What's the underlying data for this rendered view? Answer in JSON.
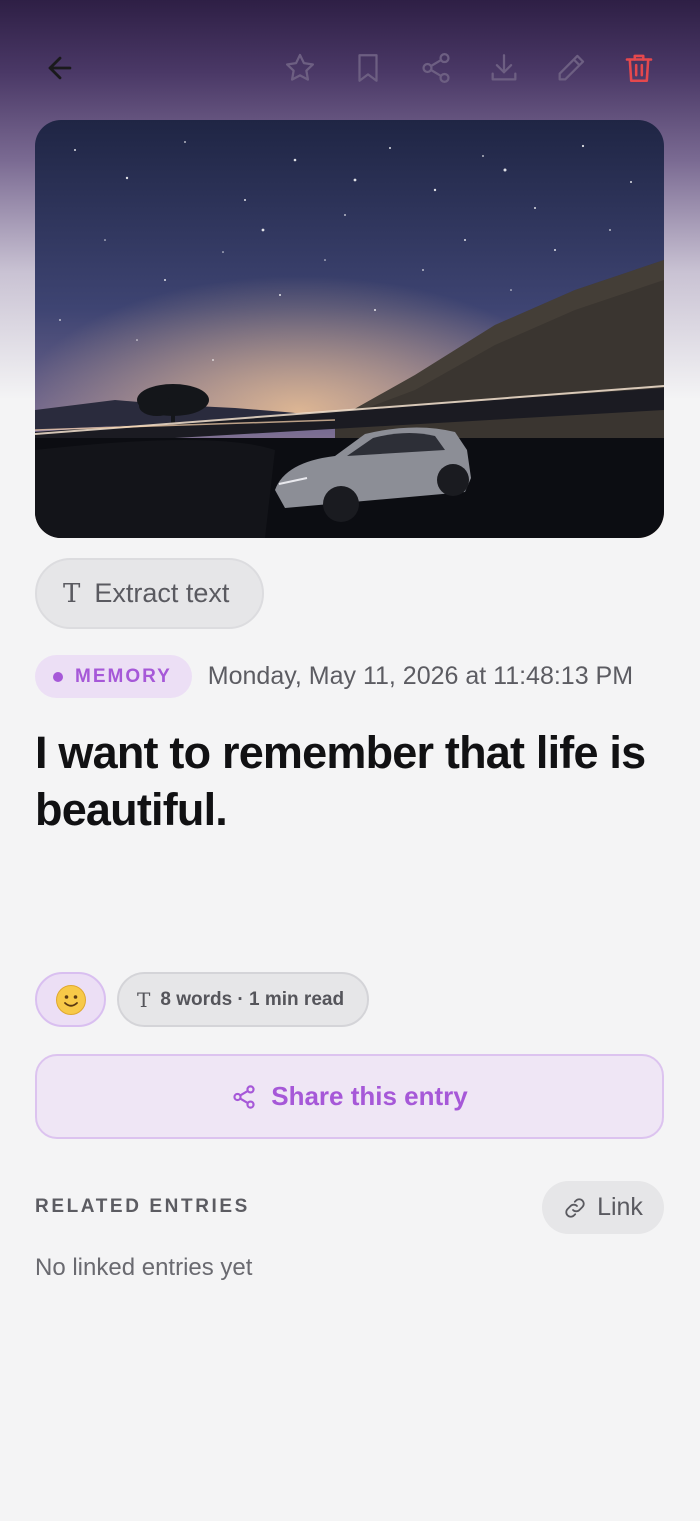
{
  "toolbar": {
    "icons": [
      "back-arrow-icon",
      "star-icon",
      "bookmark-icon",
      "share-icon",
      "download-icon",
      "pencil-icon",
      "trash-icon"
    ],
    "delete_color": "#e5484d"
  },
  "entry": {
    "extract_label": "Extract text",
    "badge": "MEMORY",
    "date": "Monday, May 11, 2026 at 11:48:13 PM",
    "title": "I want to remember that life is beautiful.",
    "mood_emoji": "🙂",
    "stats": "8 words · 1 min read",
    "share_label": "Share this entry"
  },
  "related": {
    "heading": "RELATED ENTRIES",
    "link_label": "Link",
    "empty": "No linked entries yet"
  },
  "colors": {
    "accent": "#a658d8",
    "accent_bg": "#ecdff5",
    "background": "#f4f4f5",
    "text_dark": "#111113"
  }
}
